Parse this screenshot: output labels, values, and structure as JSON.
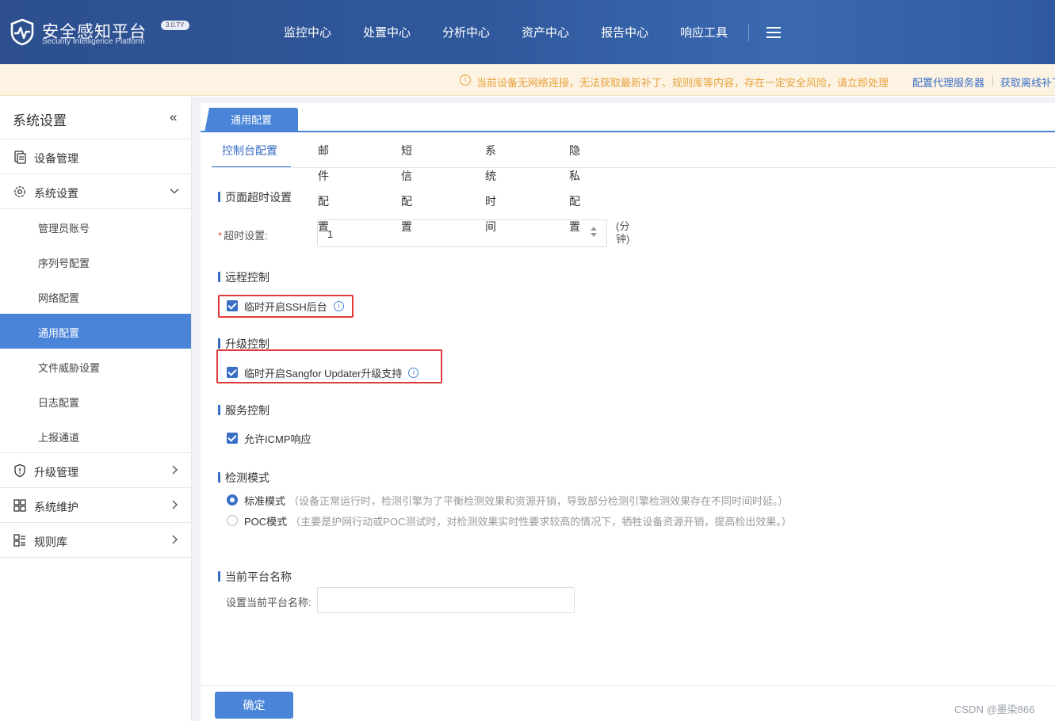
{
  "header": {
    "brand_title": "安全感知平台",
    "brand_subtitle": "Security Intelligence Platform",
    "version": "3.0.TY",
    "nav": [
      "监控中心",
      "处置中心",
      "分析中心",
      "资产中心",
      "报告中心",
      "响应工具"
    ],
    "menu_icon": "hamburger-icon"
  },
  "notice": {
    "text": "当前设备无网络连接，无法获取最新补丁、规则库等内容，存在一定安全风险，请立即处理",
    "link1": "配置代理服务器",
    "link2": "获取离线补丁"
  },
  "sidebar": {
    "title": "系统设置",
    "collapse_glyph": "«",
    "groups": [
      {
        "label": "设备管理",
        "icon": "device-icon"
      },
      {
        "label": "系统设置",
        "icon": "gear-icon"
      },
      {
        "label": "升级管理",
        "icon": "shield-icon"
      },
      {
        "label": "系统维护",
        "icon": "grid-icon"
      },
      {
        "label": "规则库",
        "icon": "rules-icon"
      }
    ],
    "sub_items": [
      "管理员账号",
      "序列号配置",
      "网络配置",
      "通用配置",
      "文件威胁设置",
      "日志配置",
      "上报通道"
    ],
    "active_sub": "通用配置"
  },
  "main": {
    "top_tab": "通用配置",
    "sub_tabs": [
      "控制台配置",
      "邮件配置",
      "短信配置",
      "系统时间",
      "隐私配置"
    ],
    "active_sub_tab": "控制台配置",
    "sections": {
      "timeout": {
        "title": "页面超时设置",
        "label": "超时设置:",
        "required_mark": "*",
        "value": "1",
        "unit": "(分钟)"
      },
      "remote": {
        "title": "远程控制",
        "checkbox": "临时开启SSH后台",
        "checked": true
      },
      "upgrade": {
        "title": "升级控制",
        "checkbox": "临时开启Sangfor Updater升级支持",
        "checked": true
      },
      "service": {
        "title": "服务控制",
        "checkbox": "允许ICMP响应",
        "checked": true
      },
      "detect": {
        "title": "检测模式",
        "options": [
          {
            "label": "标准模式",
            "desc": "（设备正常运行时，检测引擎为了平衡检测效果和资源开销，导致部分检测引擎检测效果存在不同时间时延。）",
            "selected": true
          },
          {
            "label": "POC模式",
            "desc": "（主要是护网行动或POC测试时，对检测效果实时性要求较高的情况下，牺牲设备资源开销，提高检出效果。）",
            "selected": false
          }
        ]
      },
      "platform": {
        "title": "当前平台名称",
        "label": "设置当前平台名称:",
        "value": ""
      }
    },
    "confirm_button": "确定"
  },
  "watermark": "CSDN @墨染866",
  "colors": {
    "header_bg": "#2f589c",
    "accent": "#4a84d8",
    "warning": "#e6a23c",
    "highlight_box": "#e03b3b"
  }
}
